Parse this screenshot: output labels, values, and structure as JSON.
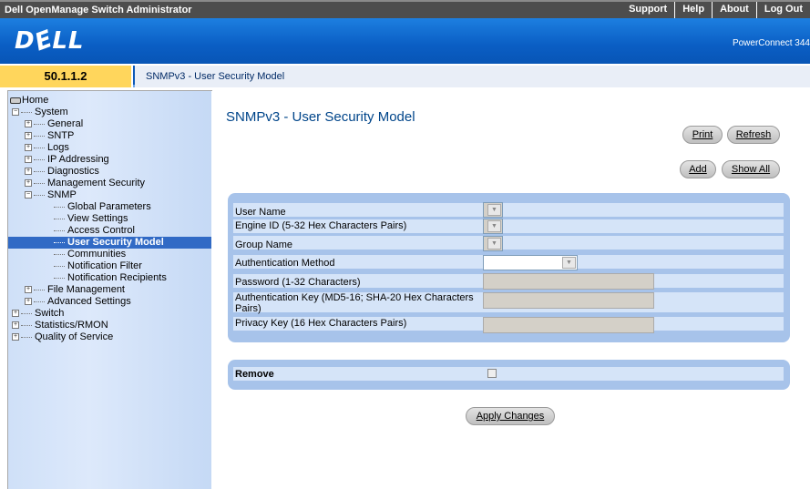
{
  "topbar": {
    "title": "Dell OpenManage Switch Administrator",
    "links": [
      "Support",
      "Help",
      "About",
      "Log Out"
    ]
  },
  "banner": {
    "logo": "D&LL",
    "product": "PowerConnect 344"
  },
  "address": {
    "ip": "50.1.1.2",
    "page": "SNMPv3 - User Security Model"
  },
  "nav": {
    "home": "Home",
    "items": [
      "System",
      "General",
      "SNTP",
      "Logs",
      "IP Addressing",
      "Diagnostics",
      "Management Security",
      "SNMP",
      "Global Parameters",
      "View Settings",
      "Access Control",
      "User Security Model",
      "Communities",
      "Notification Filter",
      "Notification Recipients",
      "File Management",
      "Advanced Settings",
      "Switch",
      "Statistics/RMON",
      "Quality of Service"
    ]
  },
  "main": {
    "title": "SNMPv3 - User Security Model",
    "buttons": {
      "print": "Print",
      "refresh": "Refresh",
      "add": "Add",
      "show_all": "Show All",
      "apply": "Apply Changes"
    },
    "fields": {
      "user_name": "User Name",
      "engine_id": "Engine ID (5-32 Hex Characters Pairs)",
      "group_name": "Group Name",
      "auth_method": "Authentication Method",
      "password": "Password (1-32 Characters)",
      "auth_key_line1": "Authentication Key (MD5-16; SHA-20 Hex Characters",
      "auth_key_line2": "Pairs)",
      "privacy_key": "Privacy Key (16 Hex Characters Pairs)"
    },
    "remove": "Remove"
  }
}
